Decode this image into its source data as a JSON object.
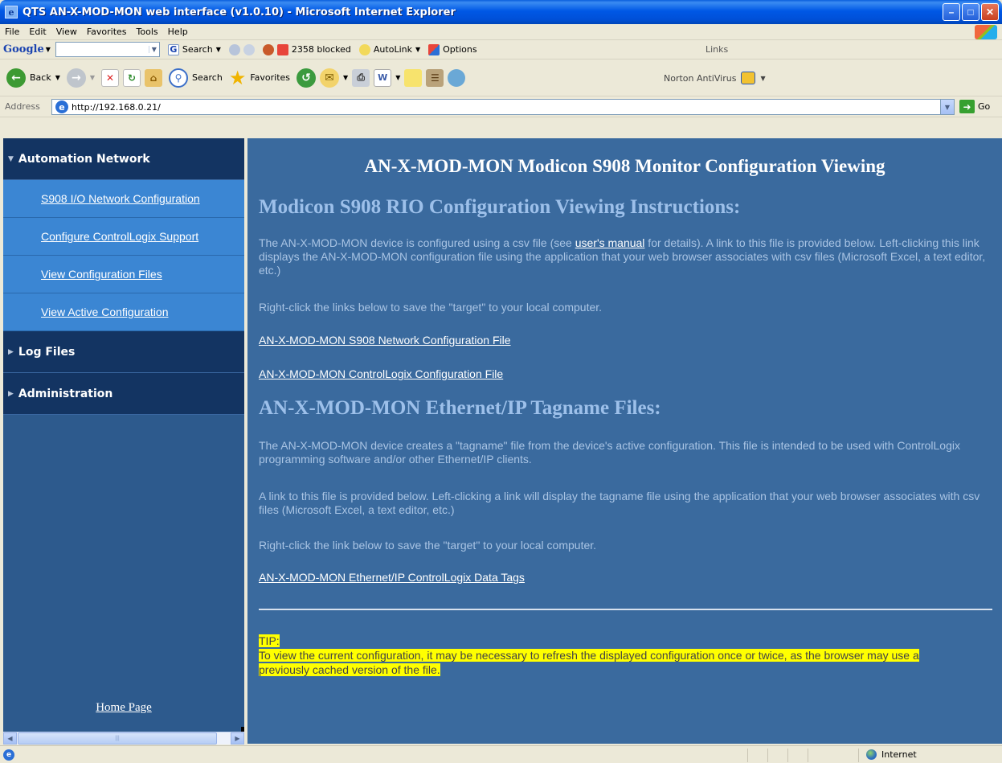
{
  "window": {
    "title": "QTS AN-X-MOD-MON web interface (v1.0.10) - Microsoft Internet Explorer"
  },
  "menu": {
    "items": [
      "File",
      "Edit",
      "View",
      "Favorites",
      "Tools",
      "Help"
    ]
  },
  "google_toolbar": {
    "logo": "Google",
    "search_label": "Search",
    "blocked_label": "2358 blocked",
    "autolink_label": "AutoLink",
    "options_label": "Options",
    "links_label": "Links"
  },
  "std_toolbar": {
    "back_label": "Back",
    "search_label": "Search",
    "favorites_label": "Favorites",
    "norton_label": "Norton AntiVirus"
  },
  "address": {
    "label": "Address",
    "url": "http://192.168.0.21/",
    "go_label": "Go"
  },
  "sidebar": {
    "sections": [
      {
        "label": "Automation Network",
        "expanded": true
      },
      {
        "label": "Log Files",
        "expanded": false
      },
      {
        "label": "Administration",
        "expanded": false
      }
    ],
    "items": [
      {
        "label": "S908 I/O Network Configuration"
      },
      {
        "label": "Configure ControlLogix Support"
      },
      {
        "label": "View Configuration Files"
      },
      {
        "label": "View Active Configuration"
      }
    ],
    "home_label": "Home Page"
  },
  "main": {
    "title": "AN-X-MOD-MON Modicon S908 Monitor Configuration Viewing",
    "heading1": "Modicon S908 RIO Configuration Viewing Instructions:",
    "para1_a": "The AN-X-MOD-MON device is configured using a csv file (see ",
    "para1_link": "user's manual",
    "para1_b": " for details). A link to this file is provided below. Left-clicking this link displays the AN-X-MOD-MON configuration file using the application that your web browser associates with csv files (Microsoft Excel, a text editor, etc.)",
    "para2": "Right-click the links below to save the \"target\" to your local computer.",
    "link1": "AN-X-MOD-MON S908 Network Configuration File",
    "link2": "AN-X-MOD-MON ControlLogix Configuration File",
    "heading2": "AN-X-MOD-MON Ethernet/IP Tagname Files:",
    "para3": "The AN-X-MOD-MON device creates a \"tagname\" file from the device's active configuration. This file is intended to be used with ControlLogix programming software and/or other Ethernet/IP clients.",
    "para4": "A link to this file is provided below. Left-clicking a link will display the tagname file using the application that your web browser associates with csv files (Microsoft Excel, a text editor, etc.)",
    "para5": "Right-click the link below to save the \"target\" to your local computer.",
    "link3": "AN-X-MOD-MON Ethernet/IP ControlLogix Data Tags",
    "tip_label": "TIP:",
    "tip_text_1": "To view the current configuration, it may be necessary to refresh the displayed configuration once or twice, as the browser may use a",
    "tip_text_2": "previously cached version of the file."
  },
  "status": {
    "zone": "Internet"
  },
  "colors": {
    "sidebar_header": "#133462",
    "sidebar_item": "#3b86d3",
    "main_bg": "#3a6a9e",
    "tip_highlight": "#ffff00"
  }
}
